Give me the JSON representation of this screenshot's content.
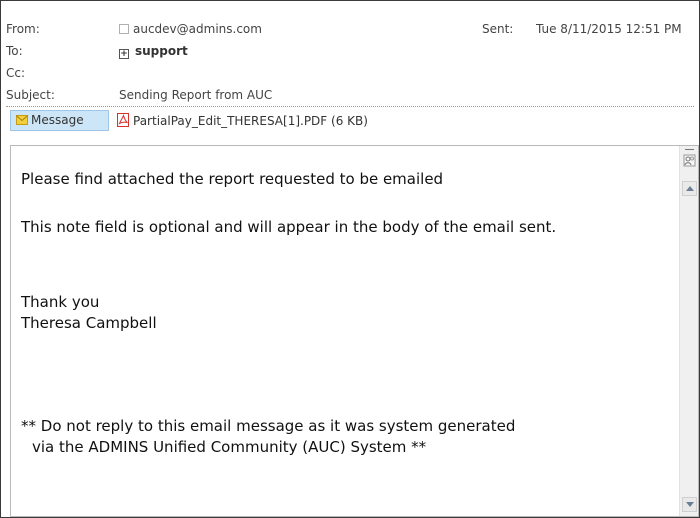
{
  "header": {
    "from_label": "From:",
    "from_value": "aucdev@admins.com",
    "sent_label": "Sent:",
    "sent_value": "Tue 8/11/2015 12:51 PM",
    "to_label": "To:",
    "to_value": "support",
    "cc_label": "Cc:",
    "subject_label": "Subject:",
    "subject_value": "Sending Report from AUC"
  },
  "attachments_bar": {
    "message_tab_label": "Message",
    "attachment_label": "PartialPay_Edit_THERESA[1].PDF (6 KB)"
  },
  "body": {
    "line1": "Please find attached the report requested to be emailed",
    "line2": "This note field is optional and will appear in the body of the email sent.",
    "line3": "Thank you",
    "line4": "Theresa Campbell",
    "line5": "** Do not reply to this email message as it was system generated",
    "line6": "via the ADMINS Unified Community (AUC) System **"
  },
  "icons": {
    "message_tab": "envelope-icon",
    "attachment": "pdf-icon",
    "to_group": "expand-plus-icon",
    "from_contact": "contact-status-icon",
    "scrollbar_people": "people-pane-icon"
  },
  "colors": {
    "message_tab_bg": "#cde6f7",
    "envelope": "#f3cf3c",
    "pdf_red": "#d9302c"
  }
}
